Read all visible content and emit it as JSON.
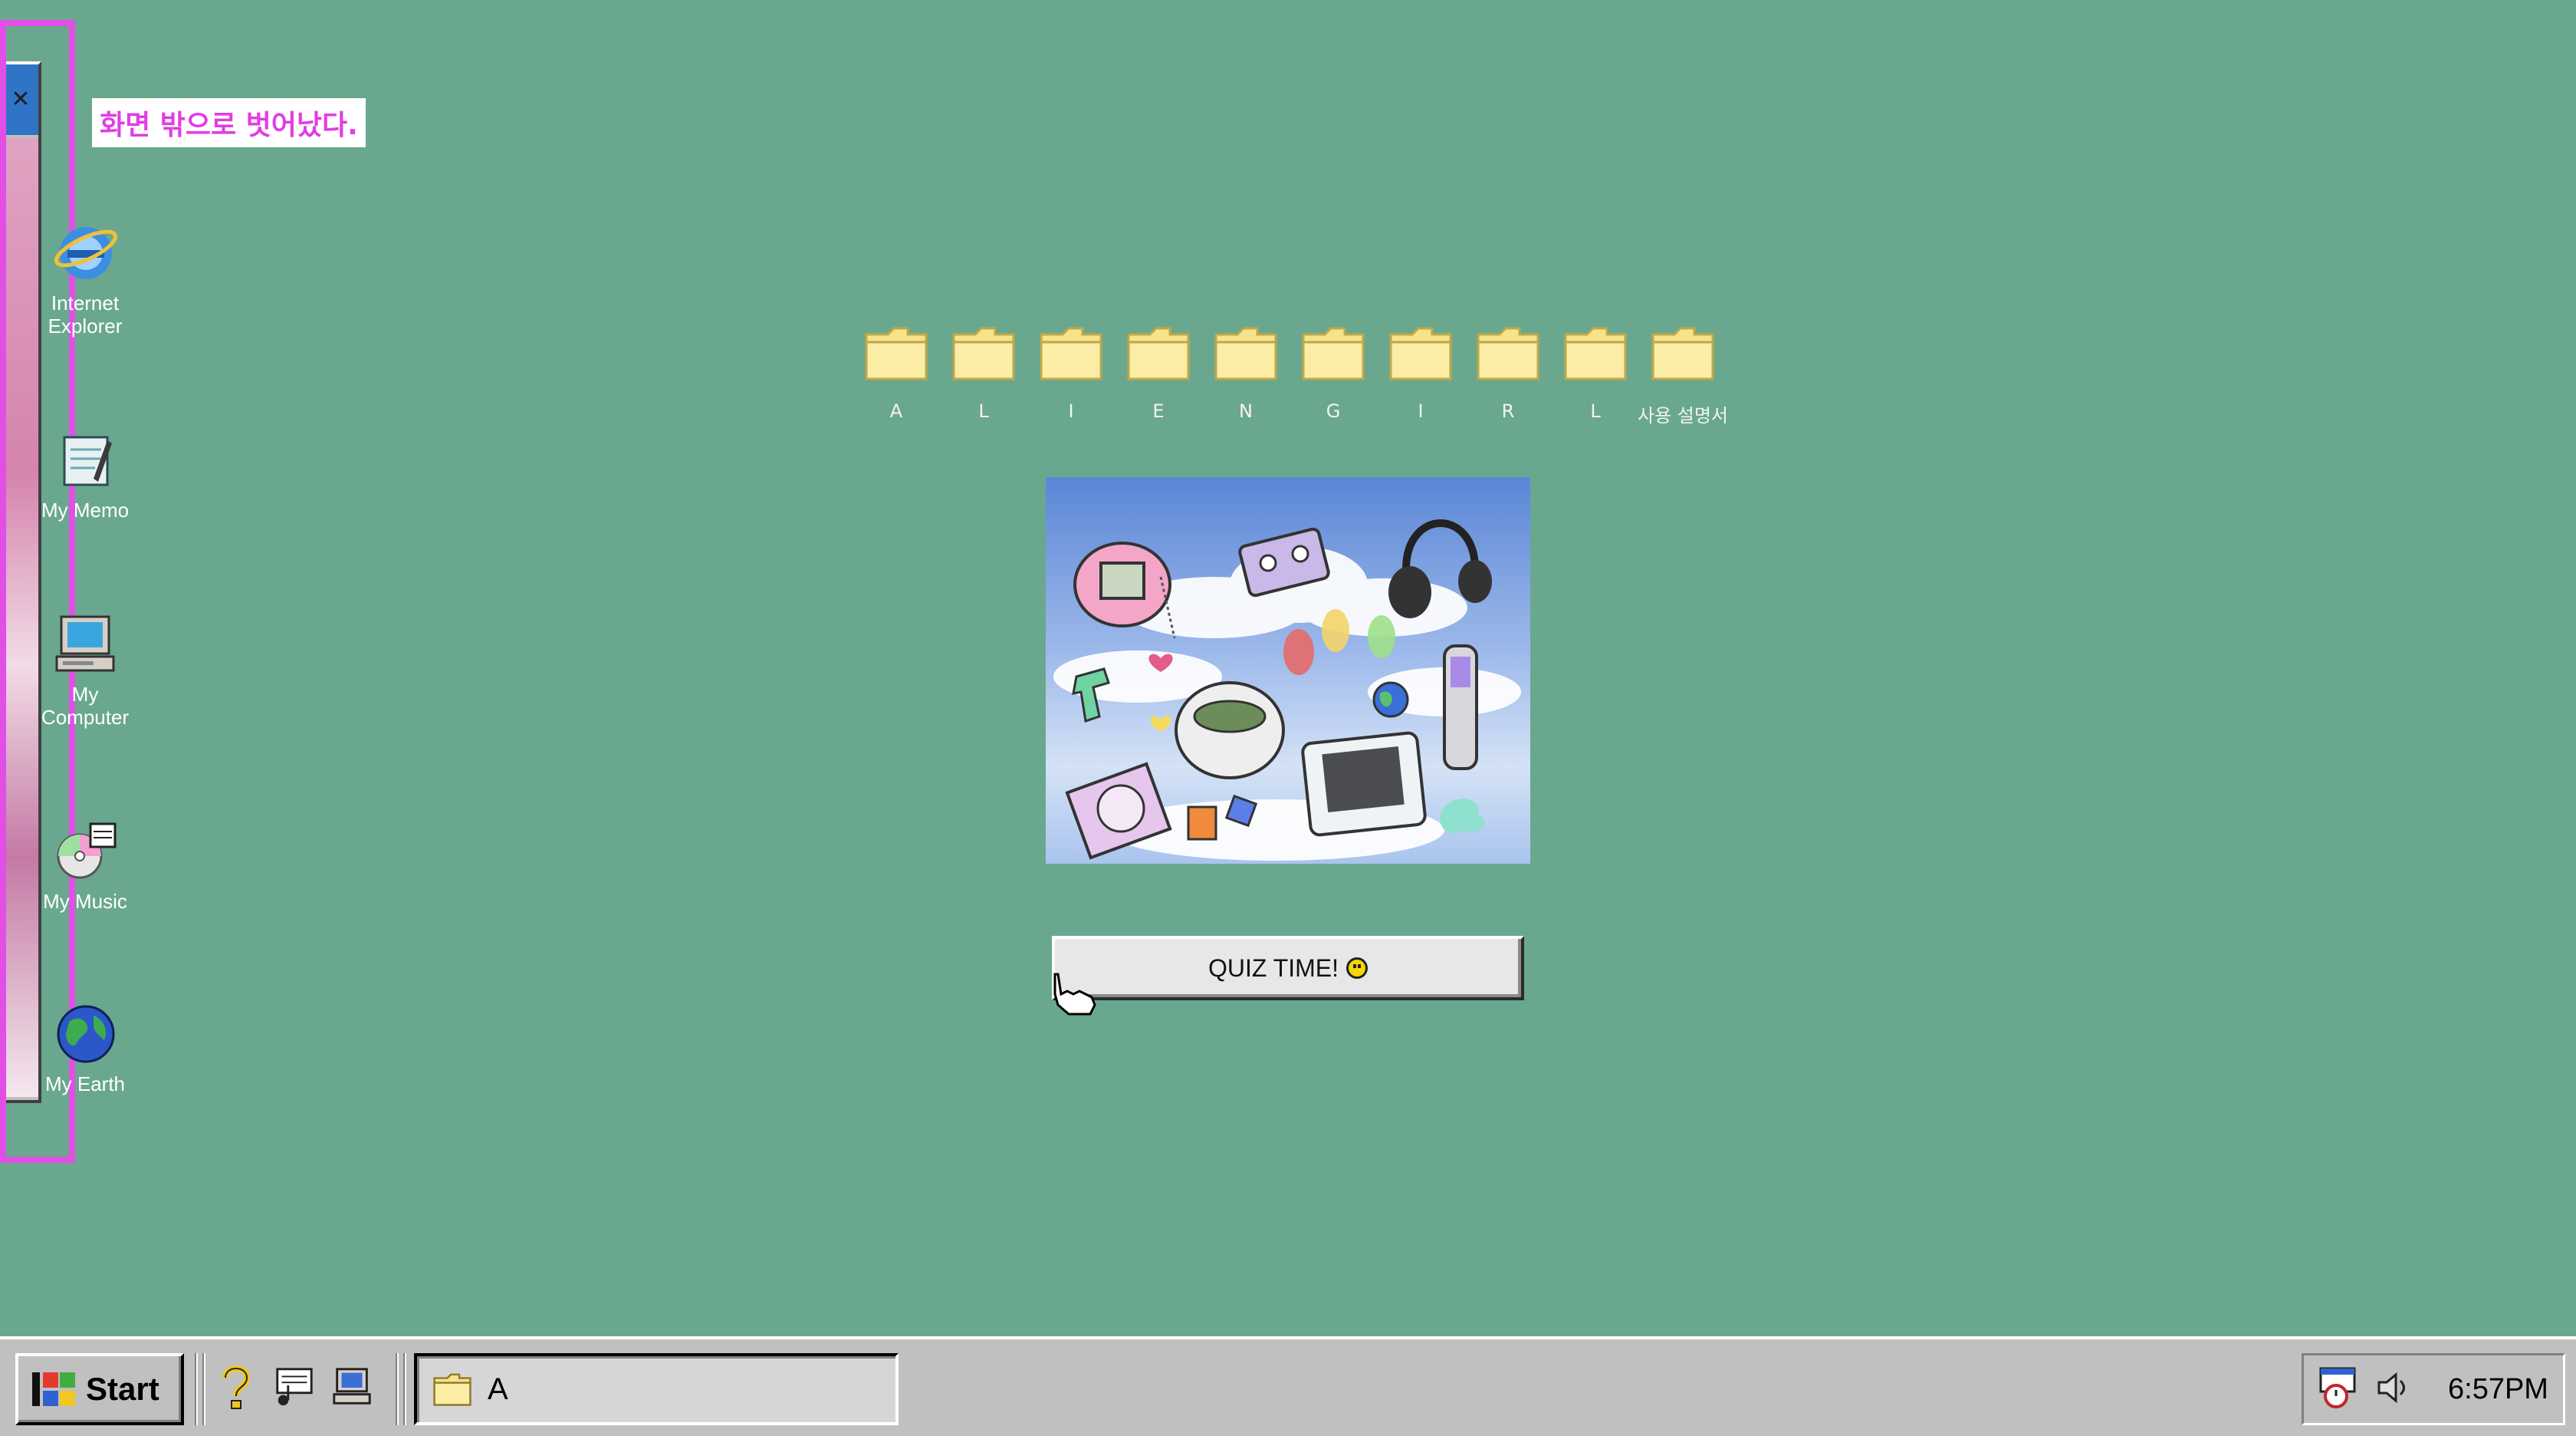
{
  "offscreen": {
    "label": "화면 밖으로 벗어났다."
  },
  "desktop_icons": [
    {
      "label": "Internet Explorer",
      "icon": "internet-explorer-icon"
    },
    {
      "label": "My Memo",
      "icon": "memo-icon"
    },
    {
      "label": "My Computer",
      "icon": "computer-icon"
    },
    {
      "label": "My Music",
      "icon": "music-icon"
    },
    {
      "label": "My Earth",
      "icon": "earth-icon"
    }
  ],
  "folders": [
    "A",
    "L",
    "I",
    "E",
    "N",
    "G",
    "I",
    "R",
    "L",
    "사용 설명서"
  ],
  "quiz": {
    "label": "QUIZ TIME!"
  },
  "taskbar": {
    "start_label": "Start",
    "task_label": "A",
    "clock": "6:57PM"
  },
  "colors": {
    "desktop": "#69a88e",
    "highlight": "#e24fe6",
    "taskbar": "#c0c0c0"
  }
}
